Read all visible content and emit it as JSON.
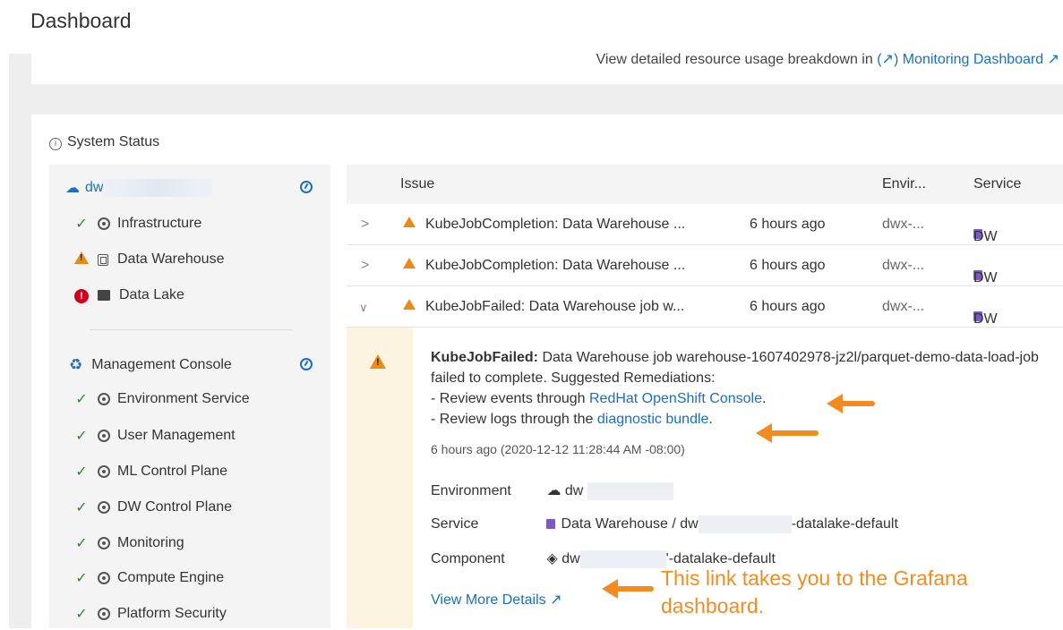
{
  "page_title": "Dashboard",
  "top_card": {
    "text": "View detailed resource usage breakdown in",
    "link": "Monitoring Dashboard"
  },
  "system_status": {
    "title": "System Status",
    "environment": {
      "name": "dw",
      "items": [
        {
          "label": "Infrastructure",
          "status": "ok"
        },
        {
          "label": "Data Warehouse",
          "status": "warning"
        },
        {
          "label": "Data Lake",
          "status": "error"
        }
      ]
    },
    "management_console": {
      "name": "Management Console",
      "items": [
        {
          "label": "Environment Service",
          "status": "ok"
        },
        {
          "label": "User Management",
          "status": "ok"
        },
        {
          "label": "ML Control Plane",
          "status": "ok"
        },
        {
          "label": "DW Control Plane",
          "status": "ok"
        },
        {
          "label": "Monitoring",
          "status": "ok"
        },
        {
          "label": "Compute Engine",
          "status": "ok"
        },
        {
          "label": "Platform Security",
          "status": "ok"
        }
      ]
    }
  },
  "issues_table": {
    "headers": {
      "issue": "Issue",
      "env": "Envir...",
      "service": "Service"
    },
    "rows": [
      {
        "issue": "KubeJobCompletion: Data Warehouse ...",
        "time": "6 hours ago",
        "env": "dwx-...",
        "service": "DW"
      },
      {
        "issue": "KubeJobCompletion: Data Warehouse ...",
        "time": "6 hours ago",
        "env": "dwx-...",
        "service": "DW"
      },
      {
        "issue": "KubeJobFailed: Data Warehouse job w...",
        "time": "6 hours ago",
        "env": "dwx-...",
        "service": "DW"
      }
    ]
  },
  "detail": {
    "title": "KubeJobFailed:",
    "message": " Data Warehouse job warehouse-1607402978-jz2l/parquet-demo-data-load-job failed to complete. Suggested Remediations:",
    "remediation1_prefix": "- Review events through ",
    "remediation1_link": "RedHat OpenShift Console",
    "remediation1_suffix": ".",
    "remediation2_prefix": "- Review logs through the ",
    "remediation2_link": "diagnostic bundle",
    "remediation2_suffix": ".",
    "timestamp": "6 hours ago (2020-12-12 11:28:44 AM -08:00)",
    "environment_label": "Environment",
    "environment_value": "dw",
    "service_label": "Service",
    "service_value_prefix": "Data Warehouse / dw",
    "service_value_suffix": "-datalake-default",
    "component_label": "Component",
    "component_value_prefix": "dw",
    "component_value_suffix": "'-datalake-default",
    "view_more": "View More Details"
  },
  "callout_text": "This link takes you to the Grafana dashboard.",
  "colors": {
    "accent": "#1a6fc0",
    "warning": "#e98b14",
    "error": "#d0021b",
    "ok": "#2e8540",
    "annotation": "#f28c1f"
  }
}
